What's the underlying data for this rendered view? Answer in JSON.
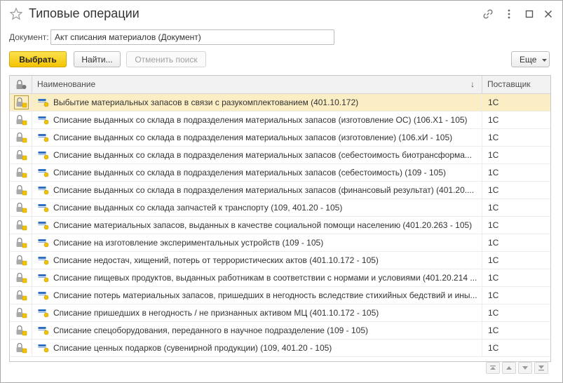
{
  "window": {
    "title": "Типовые операции"
  },
  "document_field": {
    "label": "Документ:",
    "value": "Акт списания материалов (Документ)"
  },
  "toolbar": {
    "select_label": "Выбрать",
    "find_label": "Найти...",
    "cancel_search_label": "Отменить поиск",
    "more_label": "Еще"
  },
  "table": {
    "columns": {
      "name": "Наименование",
      "supplier": "Поставщик"
    },
    "sort_indicator": "↓",
    "rows": [
      {
        "name": "Выбытие материальных запасов в связи с разукомплектованием (401.10.172)",
        "supplier": "1С"
      },
      {
        "name": "Списание выданных со склада в подразделения материальных запасов (изготовление ОС) (106.Х1 - 105)",
        "supplier": "1С"
      },
      {
        "name": "Списание выданных со склада в подразделения материальных запасов (изготовление) (106.хИ - 105)",
        "supplier": "1С"
      },
      {
        "name": "Списание выданных со склада в подразделения материальных запасов (себестоимость биотрансформа...",
        "supplier": "1С"
      },
      {
        "name": "Списание выданных со склада в подразделения материальных запасов (себестоимость) (109 - 105)",
        "supplier": "1С"
      },
      {
        "name": "Списание выданных со склада в подразделения материальных запасов (финансовый результат) (401.20....",
        "supplier": "1С"
      },
      {
        "name": "Списание выданных со склада запчастей к транспорту (109, 401.20 - 105)",
        "supplier": "1С"
      },
      {
        "name": "Списание материальных запасов, выданных в качестве социальной помощи населению (401.20.263 - 105)",
        "supplier": "1С"
      },
      {
        "name": "Списание на изготовление экспериментальных устройств (109 - 105)",
        "supplier": "1С"
      },
      {
        "name": "Списание недостач, хищений, потерь от террористических актов (401.10.172 - 105)",
        "supplier": "1С"
      },
      {
        "name": "Списание пищевых продуктов, выданных работникам в соответствии с нормами и условиями (401.20.214 ...",
        "supplier": "1С"
      },
      {
        "name": "Списание потерь материальных запасов, пришедших в негодность вследствие стихийных бедствий и ины...",
        "supplier": "1С"
      },
      {
        "name": "Списание пришедших в негодность / не признанных активом МЦ (401.10.172 - 105)",
        "supplier": "1С"
      },
      {
        "name": "Списание спецоборудования, переданного в научное подразделение (109 - 105)",
        "supplier": "1С"
      },
      {
        "name": "Списание ценных подарков (сувенирной продукции) (109, 401.20 - 105)",
        "supplier": "1С"
      }
    ],
    "selected_row": 0
  },
  "icons": {
    "favorite": "star-icon",
    "link": "link-icon",
    "menu": "more-vertical-icon",
    "maximize": "maximize-icon",
    "close": "close-icon",
    "lock": "lock-icon",
    "operation": "operation-icon"
  },
  "colors": {
    "primary_button": "#f3c300",
    "selected_row": "#fbeec5",
    "lock_yellow": "#f2c200"
  }
}
